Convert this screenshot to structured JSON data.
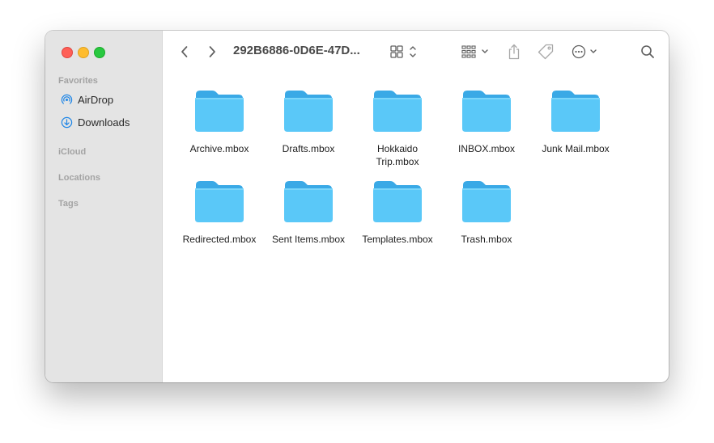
{
  "window": {
    "title": "292B6886-0D6E-47D..."
  },
  "sidebar": {
    "sections": [
      {
        "heading": "Favorites",
        "items": [
          {
            "label": "AirDrop",
            "icon": "airdrop-icon"
          },
          {
            "label": "Downloads",
            "icon": "download-icon"
          }
        ]
      },
      {
        "heading": "iCloud",
        "items": []
      },
      {
        "heading": "Locations",
        "items": []
      },
      {
        "heading": "Tags",
        "items": []
      }
    ]
  },
  "toolbar": {
    "back": "chevron-left-icon",
    "forward": "chevron-right-icon",
    "view_mode": "grid-view-icon",
    "group": "group-by-icon",
    "share": "share-icon",
    "tags": "tag-icon",
    "more": "ellipsis-circle-icon",
    "search": "search-icon"
  },
  "files": [
    {
      "name": "Archive.mbox",
      "name2": ""
    },
    {
      "name": "Drafts.mbox",
      "name2": ""
    },
    {
      "name": "Hokkaido",
      "name2": "Trip.mbox"
    },
    {
      "name": "INBOX.mbox",
      "name2": ""
    },
    {
      "name": "Junk Mail.mbox",
      "name2": ""
    },
    {
      "name": "Redirected.mbox",
      "name2": ""
    },
    {
      "name": "Sent Items.mbox",
      "name2": ""
    },
    {
      "name": "Templates.mbox",
      "name2": ""
    },
    {
      "name": "Trash.mbox",
      "name2": ""
    }
  ],
  "colors": {
    "folder_front": "#5ac8f8",
    "folder_back": "#3aa9e6",
    "accent": "#1f86e6"
  }
}
